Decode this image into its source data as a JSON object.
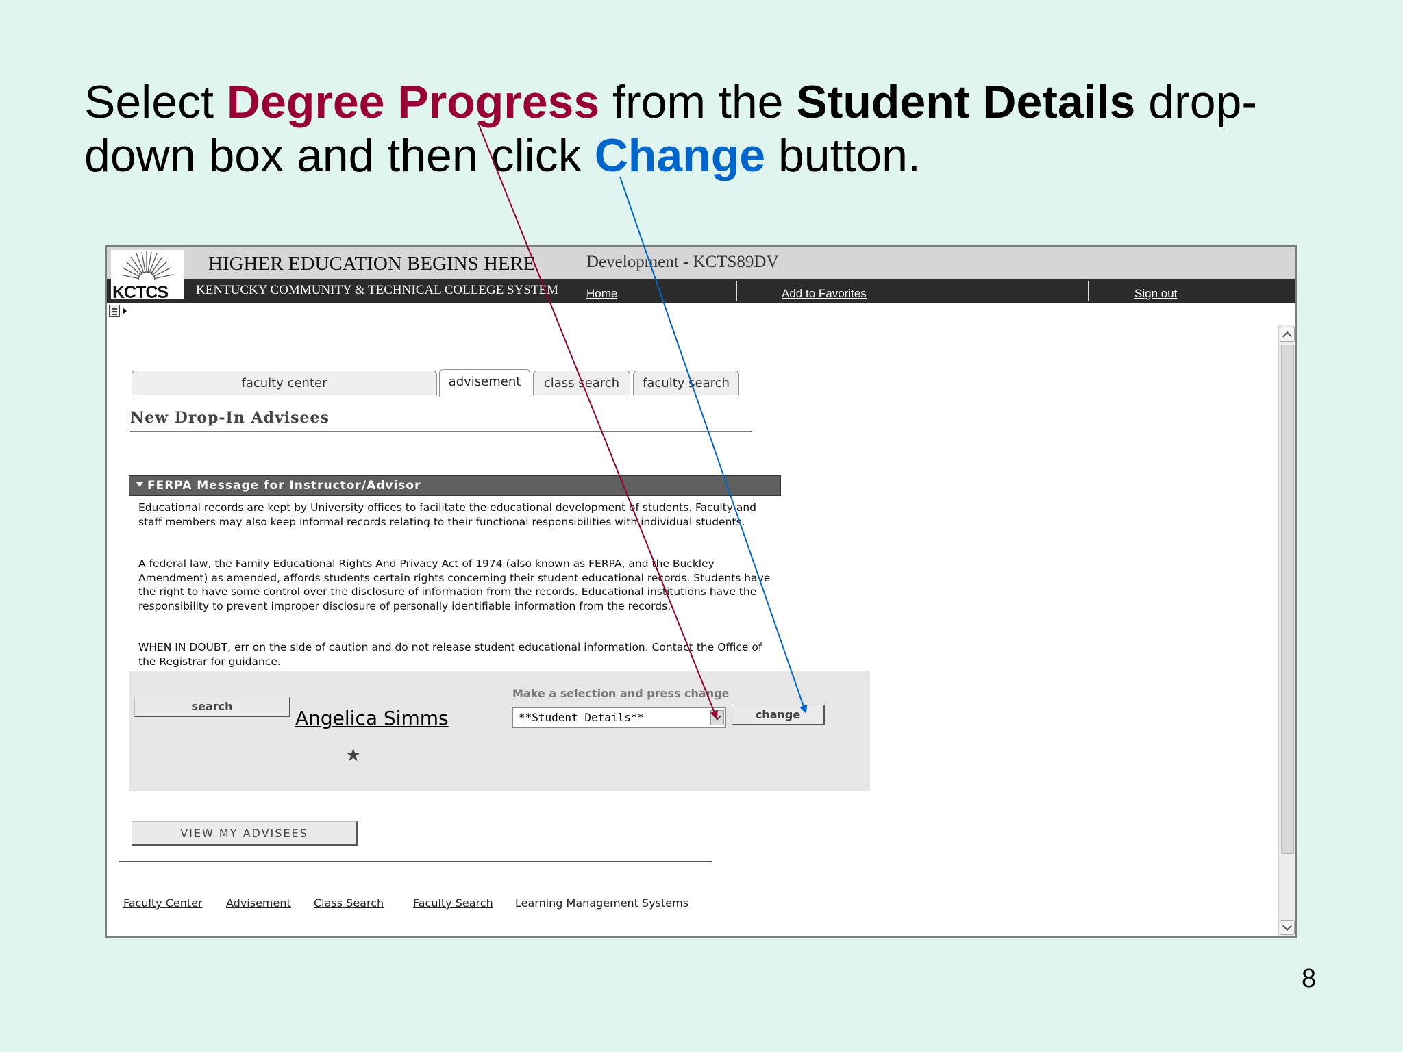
{
  "instruction": {
    "part1": "Select ",
    "degree_progress": "Degree Progress",
    "part2": " from the ",
    "student_details": "Student Details",
    "part3": " drop-down box and then click ",
    "change": "Change",
    "part4": " button."
  },
  "slide_number": "8",
  "header": {
    "logo_text": "KCTCS",
    "tagline": "HIGHER EDUCATION BEGINS HERE",
    "environment": "Development - KCTS89DV",
    "college_name": "KENTUCKY COMMUNITY & TECHNICAL COLLEGE SYSTEM",
    "links": {
      "home": "Home",
      "favorites": "Add to Favorites",
      "signout": "Sign out"
    }
  },
  "tabs": [
    "faculty center",
    "advisement",
    "class search",
    "faculty search"
  ],
  "active_tab": "advisement",
  "page_title": "New Drop-In Advisees",
  "ferpa": {
    "title": "FERPA Message for Instructor/Advisor",
    "p1": "Educational records are kept by University offices to facilitate the educational development of students. Faculty and staff members may also keep informal records relating to their functional responsibilities with individual students.",
    "p2": "A federal law, the Family Educational Rights And Privacy Act of 1974 (also known as FERPA, and the Buckley Amendment) as amended, affords students certain rights concerning their student educational records. Students have the right to have some control over the disclosure of information from the records. Educational institutions have the responsibility to prevent improper disclosure of personally identifiable information from the records.",
    "p3": "WHEN IN DOUBT, err on the side of caution and do not release student educational information. Contact the Office of the Registrar for guidance."
  },
  "search_panel": {
    "search_button": "search",
    "student_name": "Angelica Simms",
    "select_label": "Make a selection and press change",
    "select_value": "**Student Details**",
    "change_button": "change"
  },
  "view_advisees_button": "VIEW MY ADVISEES",
  "footer_links": [
    "Faculty Center",
    "Advisement",
    "Class Search",
    "Faculty Search"
  ],
  "footer_plain": "Learning Management Systems",
  "colors": {
    "degree": "#990033",
    "change": "#0066cc",
    "background": "#e0f5ef"
  },
  "icons": [
    "menu-icon",
    "star-icon",
    "scroll-up-icon",
    "scroll-down-icon",
    "dropdown-arrow-icon",
    "sun-logo-icon"
  ]
}
